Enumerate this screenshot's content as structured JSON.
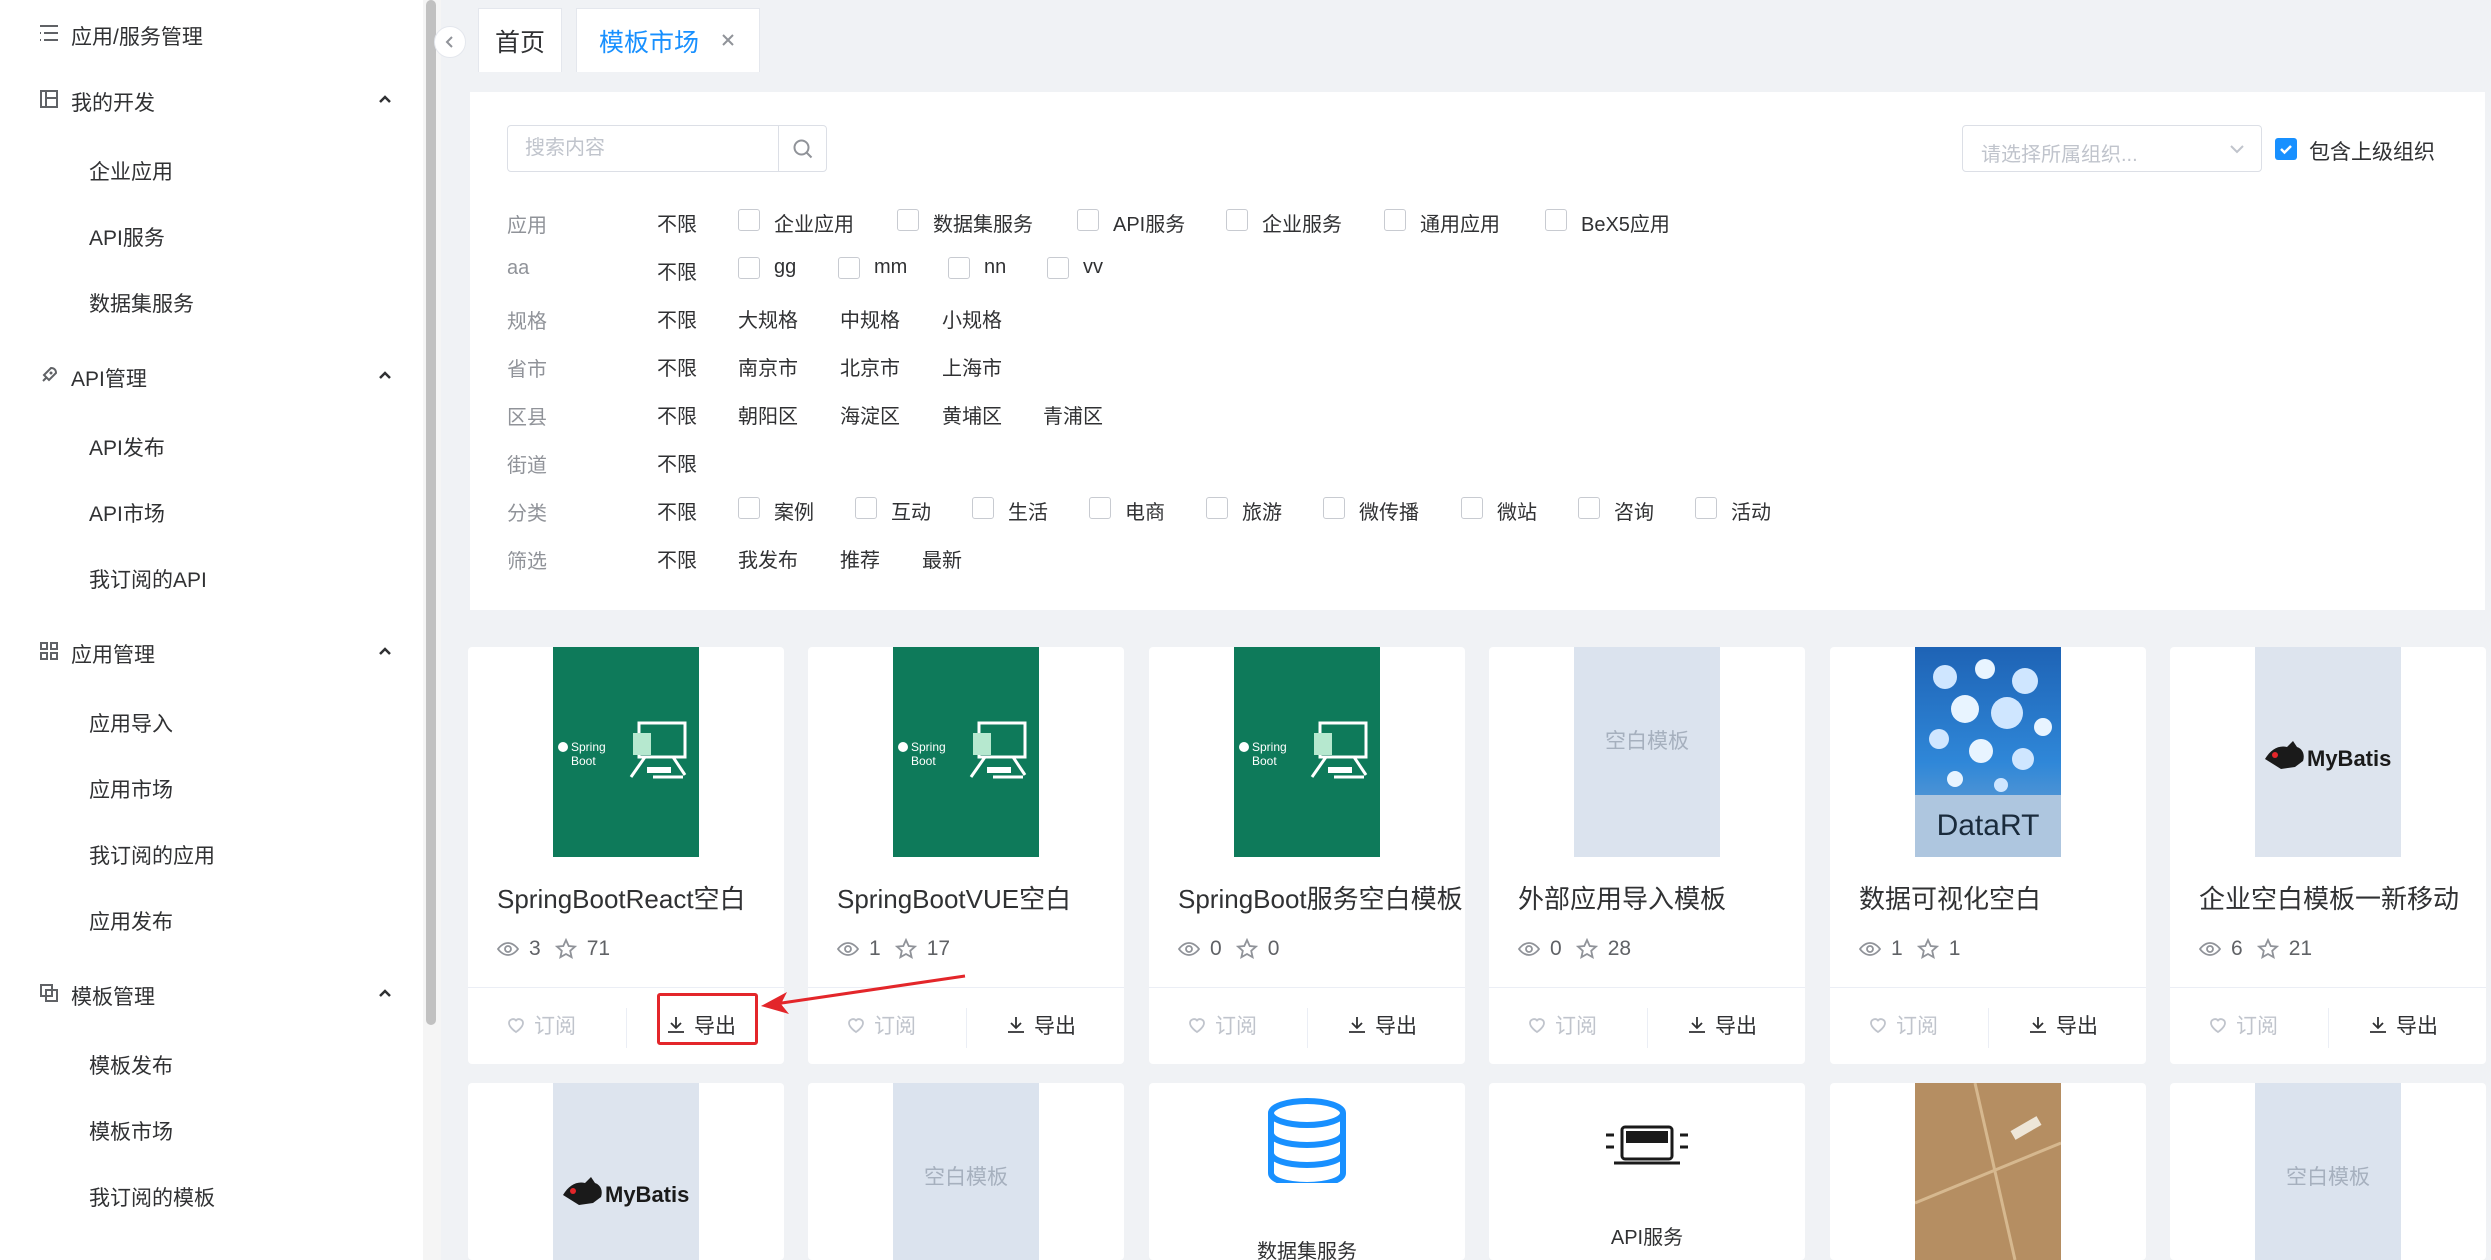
{
  "sidebar": {
    "top_item": "应用/服务管理",
    "groups": [
      {
        "label": "我的开发",
        "items": [
          "企业应用",
          "API服务",
          "数据集服务"
        ]
      },
      {
        "label": "API管理",
        "items": [
          "API发布",
          "API市场",
          "我订阅的API"
        ]
      },
      {
        "label": "应用管理",
        "items": [
          "应用导入",
          "应用市场",
          "我订阅的应用",
          "应用发布"
        ]
      },
      {
        "label": "模板管理",
        "items": [
          "模板发布",
          "模板市场",
          "我订阅的模板"
        ]
      }
    ]
  },
  "tabs": {
    "home": "首页",
    "market": "模板市场"
  },
  "search": {
    "placeholder": "搜索内容"
  },
  "org_select": {
    "placeholder": "请选择所属组织...",
    "include_parent_label": "包含上级组织",
    "include_parent_checked": true
  },
  "filters": [
    {
      "label": "应用",
      "all": "不限",
      "checkbox": true,
      "options": [
        "企业应用",
        "数据集服务",
        "API服务",
        "企业服务",
        "通用应用",
        "BeX5应用"
      ]
    },
    {
      "label": "aa",
      "all": "不限",
      "checkbox": true,
      "options": [
        "gg",
        "mm",
        "nn",
        "vv"
      ]
    },
    {
      "label": "规格",
      "all": "不限",
      "checkbox": false,
      "options": [
        "大规格",
        "中规格",
        "小规格"
      ]
    },
    {
      "label": "省市",
      "all": "不限",
      "checkbox": false,
      "options": [
        "南京市",
        "北京市",
        "上海市"
      ]
    },
    {
      "label": "区县",
      "all": "不限",
      "checkbox": false,
      "options": [
        "朝阳区",
        "海淀区",
        "黄埔区",
        "青浦区"
      ]
    },
    {
      "label": "街道",
      "all": "不限",
      "checkbox": false,
      "options": []
    },
    {
      "label": "分类",
      "all": "不限",
      "checkbox": true,
      "options": [
        "案例",
        "互动",
        "生活",
        "电商",
        "旅游",
        "微传播",
        "微站",
        "咨询",
        "活动"
      ]
    },
    {
      "label": "筛选",
      "all": "不限",
      "checkbox": false,
      "options": [
        "我发布",
        "推荐",
        "最新"
      ]
    }
  ],
  "cards": [
    {
      "title": "SpringBootReact空白",
      "views": "3",
      "stars": "71",
      "image": "springboot-logo",
      "subscribe": "订阅",
      "export": "导出"
    },
    {
      "title": "SpringBootVUE空白",
      "views": "1",
      "stars": "17",
      "image": "springboot-logo",
      "subscribe": "订阅",
      "export": "导出"
    },
    {
      "title": "SpringBoot服务空白模板",
      "views": "0",
      "stars": "0",
      "image": "springboot-logo",
      "subscribe": "订阅",
      "export": "导出"
    },
    {
      "title": "外部应用导入模板",
      "views": "0",
      "stars": "28",
      "image": "blank-template",
      "image_text": "空白模板",
      "subscribe": "订阅",
      "export": "导出"
    },
    {
      "title": "数据可视化空白",
      "views": "1",
      "stars": "1",
      "image": "datart-logo",
      "image_text": "DataRT",
      "subscribe": "订阅",
      "export": "导出"
    },
    {
      "title": "企业空白模板一新移动",
      "views": "6",
      "stars": "21",
      "image": "mybatis-logo",
      "image_text": "MyBatis",
      "subscribe": "订阅",
      "export": "导出"
    }
  ],
  "cards_row2": [
    {
      "image": "mybatis-logo",
      "image_text": "MyBatis"
    },
    {
      "image": "blank-template",
      "image_text": "空白模板"
    },
    {
      "image": "database-icon",
      "image_text": "数据集服务"
    },
    {
      "image": "api-icon",
      "image_text": "API服务"
    },
    {
      "image": "kraft-paper-photo"
    },
    {
      "image": "blank-template",
      "image_text": "空白模板"
    }
  ],
  "springboot_text": {
    "line1": "Spring",
    "line2": "Boot"
  },
  "colors": {
    "primary": "#1890ff",
    "highlight": "#e3262a",
    "springboot_green": "#0e7a5a"
  }
}
